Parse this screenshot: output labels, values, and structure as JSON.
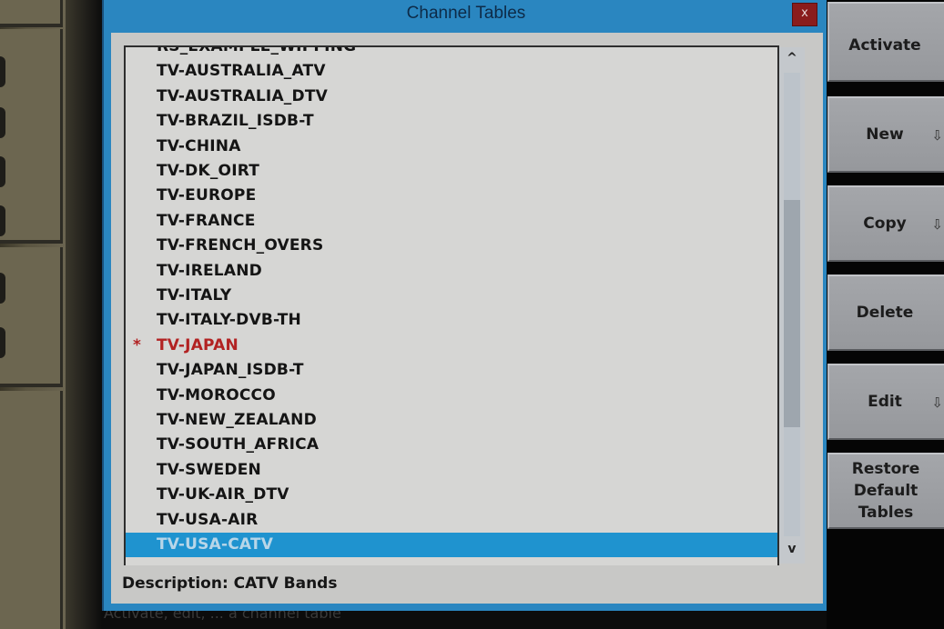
{
  "dialog": {
    "title": "Channel Tables",
    "close_label": "x"
  },
  "list": {
    "items": [
      {
        "label": "RS_EXAMPLE_WIPFING",
        "state": "normal"
      },
      {
        "label": "TV-AUSTRALIA_ATV",
        "state": "normal"
      },
      {
        "label": "TV-AUSTRALIA_DTV",
        "state": "normal"
      },
      {
        "label": "TV-BRAZIL_ISDB-T",
        "state": "normal"
      },
      {
        "label": "TV-CHINA",
        "state": "normal"
      },
      {
        "label": "TV-DK_OIRT",
        "state": "normal"
      },
      {
        "label": "TV-EUROPE",
        "state": "normal"
      },
      {
        "label": "TV-FRANCE",
        "state": "normal"
      },
      {
        "label": "TV-FRENCH_OVERS",
        "state": "normal"
      },
      {
        "label": "TV-IRELAND",
        "state": "normal"
      },
      {
        "label": "TV-ITALY",
        "state": "normal"
      },
      {
        "label": "TV-ITALY-DVB-TH",
        "state": "normal"
      },
      {
        "label": "TV-JAPAN",
        "state": "active",
        "marker": "*"
      },
      {
        "label": "TV-JAPAN_ISDB-T",
        "state": "normal"
      },
      {
        "label": "TV-MOROCCO",
        "state": "normal"
      },
      {
        "label": "TV-NEW_ZEALAND",
        "state": "normal"
      },
      {
        "label": "TV-SOUTH_AFRICA",
        "state": "normal"
      },
      {
        "label": "TV-SWEDEN",
        "state": "normal"
      },
      {
        "label": "TV-UK-AIR_DTV",
        "state": "normal"
      },
      {
        "label": "TV-USA-AIR",
        "state": "normal"
      },
      {
        "label": "TV-USA-CATV",
        "state": "selected"
      }
    ],
    "scroll_up_icon": "^",
    "scroll_down_icon": "v"
  },
  "description": "Description: CATV Bands",
  "status_text": "Activate, edit, ... a channel table",
  "softkeys": [
    {
      "label": "Activate",
      "has_submenu": false
    },
    {
      "label": "New",
      "has_submenu": true
    },
    {
      "label": "Copy",
      "has_submenu": true
    },
    {
      "label": "Delete",
      "has_submenu": false
    },
    {
      "label": "Edit",
      "has_submenu": true
    },
    {
      "label": "Restore Default Tables",
      "has_submenu": false
    }
  ],
  "submenu_arrow": "⇩",
  "colors": {
    "title_bar": "#2a86c0",
    "selection": "#1f93cf",
    "active_item": "#b22222",
    "close_button": "#8a1c1c"
  }
}
